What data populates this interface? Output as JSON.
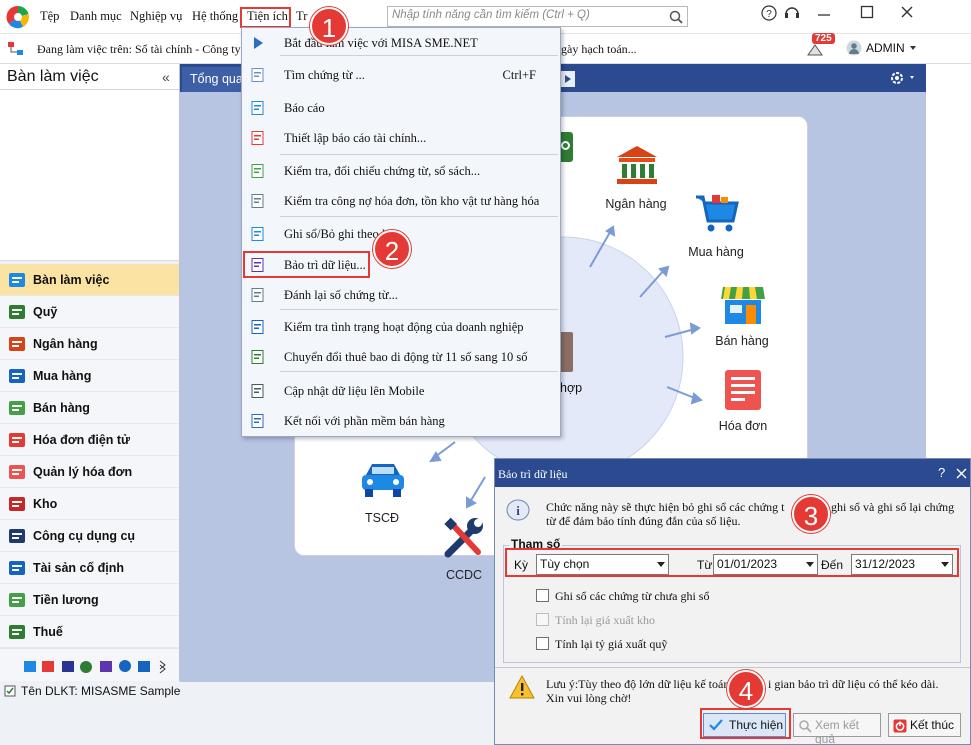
{
  "menubar": {
    "items": [
      "Tệp",
      "Danh mục",
      "Nghiệp vụ",
      "Hệ thống",
      "Tiện ích",
      "Tr"
    ],
    "search_placeholder": "Nhập tính năng cần tìm kiếm (Ctrl + Q)"
  },
  "infobar": {
    "workspace_text": "Đang làm việc trên: Sổ tài chính - Công ty",
    "accounting_date_fragment": "gày hạch toán...",
    "notification_count": "725",
    "user": "ADMIN"
  },
  "sidebar": {
    "title": "Bàn làm việc",
    "collapse_glyph": "«",
    "items": [
      {
        "label": "Bàn làm việc",
        "icon": "dashboard-icon",
        "active": true
      },
      {
        "label": "Quỹ",
        "icon": "cash-icon"
      },
      {
        "label": "Ngân hàng",
        "icon": "bank-icon"
      },
      {
        "label": "Mua hàng",
        "icon": "shopping-cart-icon"
      },
      {
        "label": "Bán hàng",
        "icon": "store-icon"
      },
      {
        "label": "Hóa đơn điện tử",
        "icon": "e-invoice-icon"
      },
      {
        "label": "Quản lý hóa đơn",
        "icon": "invoice-management-icon"
      },
      {
        "label": "Kho",
        "icon": "warehouse-icon"
      },
      {
        "label": "Công cụ dụng cụ",
        "icon": "tools-icon"
      },
      {
        "label": "Tài sản cố định",
        "icon": "fixed-asset-icon"
      },
      {
        "label": "Tiền lương",
        "icon": "salary-icon"
      },
      {
        "label": "Thuế",
        "icon": "tax-icon"
      }
    ],
    "more_glyph": "»"
  },
  "statusbar": {
    "text": "Tên DLKT: MISASME Sample"
  },
  "tabs": {
    "active": "Tổng quan"
  },
  "workflow": {
    "modules": [
      "Ngân hàng",
      "Mua hàng",
      "Bán hàng",
      "Hóa đơn",
      "TSCĐ",
      "CCDC"
    ],
    "center_fragment": "hợp"
  },
  "dropdown": {
    "items": [
      {
        "label": "Bắt đầu làm việc với MISA SME.NET",
        "icon": "play-icon"
      },
      {
        "label": "Tìm chứng từ ...",
        "shortcut": "Ctrl+F",
        "icon": "magnifier-icon"
      },
      {
        "label": "Báo cáo",
        "icon": "report-icon"
      },
      {
        "label": "Thiết lập báo cáo tài chính...",
        "icon": "report-setup-icon"
      },
      {
        "label": "Kiểm tra, đối chiếu chứng từ, sổ sách...",
        "icon": "check-document-icon"
      },
      {
        "label": "Kiểm tra công nợ hóa đơn, tồn kho vật tư hàng hóa",
        "icon": "clipboard-check-icon"
      },
      {
        "label": "Ghi sổ/Bỏ ghi theo lô",
        "icon": "batch-post-icon"
      },
      {
        "label": "Bảo trì dữ liệu...",
        "icon": "database-maintenance-icon"
      },
      {
        "label": "Đánh lại số chứng từ...",
        "icon": "renumber-icon"
      },
      {
        "label": "Kiểm tra tình trạng hoạt động của doanh nghiệp",
        "icon": "business-status-icon"
      },
      {
        "label": "Chuyển đổi thuê bao di động từ 11 số sang 10 số",
        "icon": "mobile-convert-icon"
      },
      {
        "label": "Cập nhật dữ liệu lên Mobile",
        "icon": "mobile-update-icon"
      },
      {
        "label": "Kết nối với phần mềm bán hàng",
        "icon": "connect-sales-icon"
      }
    ]
  },
  "dialog": {
    "title": "Bảo trì dữ liệu",
    "help": "?",
    "info_line1": "Chức năng này sẽ thực hiện bỏ ghi sổ các chứng t",
    "info_line1b": "ghi sổ và ghi sổ lại chứng",
    "info_line2": "từ để đảm bảo tính đúng đắn của số liệu.",
    "group_label": "Tham số",
    "period_label": "Kỳ",
    "period_value": "Tùy chọn",
    "from_label": "Từ",
    "from_value": "01/01/2023",
    "to_label": "Đến",
    "to_value": "31/12/2023",
    "options": [
      {
        "label": "Ghi sổ các chứng từ chưa ghi sổ",
        "enabled": true,
        "checked": false
      },
      {
        "label": "Tính lại giá xuất kho",
        "enabled": false,
        "checked": false
      },
      {
        "label": "Tính lại tỷ giá xuất quỹ",
        "enabled": true,
        "checked": false
      }
    ],
    "note_line1a": "Lưu ý:Tùy theo độ lớn dữ liệu kế toán",
    "note_line1b": "i gian bảo trì dữ liệu có thể kéo dài.",
    "note_line2": "Xin vui lòng chờ!",
    "buttons": {
      "execute": "Thực hiện",
      "view_result": "Xem kết quả",
      "finish": "Kết thúc"
    }
  },
  "annotations": [
    "1",
    "2",
    "3",
    "4"
  ],
  "colors": {
    "accent": "#2b4a8f",
    "highlight_red": "#e53935",
    "active_nav": "#fbe3a3"
  }
}
